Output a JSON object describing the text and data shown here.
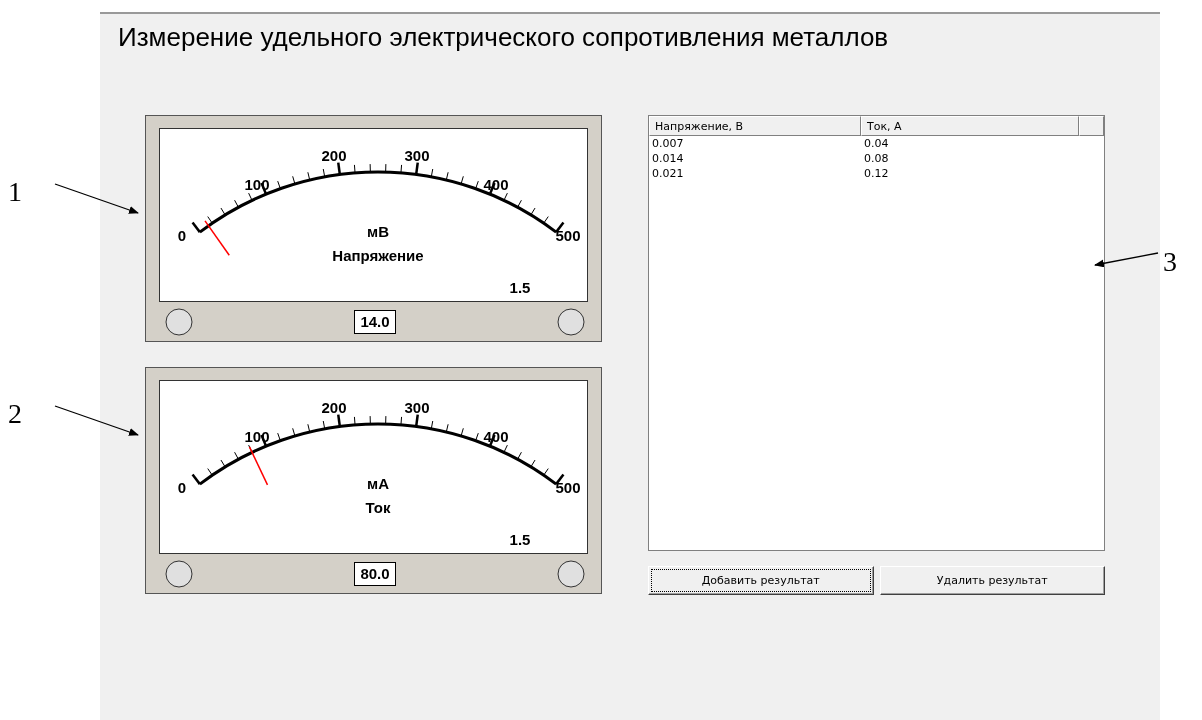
{
  "title": "Измерение удельного электрического сопротивления металлов",
  "meters": [
    {
      "scale_labels": [
        "0",
        "100",
        "200",
        "300",
        "400",
        "500"
      ],
      "unit": "мВ",
      "quantity": "Напряжение",
      "accuracy_class": "1.5",
      "level": 0.028,
      "readout": "14.0"
    },
    {
      "scale_labels": [
        "0",
        "100",
        "200",
        "300",
        "400",
        "500"
      ],
      "unit": "мА",
      "quantity": "Ток",
      "accuracy_class": "1.5",
      "level": 0.16,
      "readout": "80.0"
    }
  ],
  "table": {
    "columns": [
      "Напряжение, В",
      "Ток, А"
    ],
    "rows": [
      [
        "0.007",
        "0.04"
      ],
      [
        "0.014",
        "0.08"
      ],
      [
        "0.021",
        "0.12"
      ]
    ]
  },
  "buttons": [
    {
      "label": "Добавить результат",
      "focused": true
    },
    {
      "label": "Удалить результат",
      "focused": false
    }
  ],
  "callouts": [
    {
      "label": "1"
    },
    {
      "label": "2"
    },
    {
      "label": "3"
    }
  ]
}
